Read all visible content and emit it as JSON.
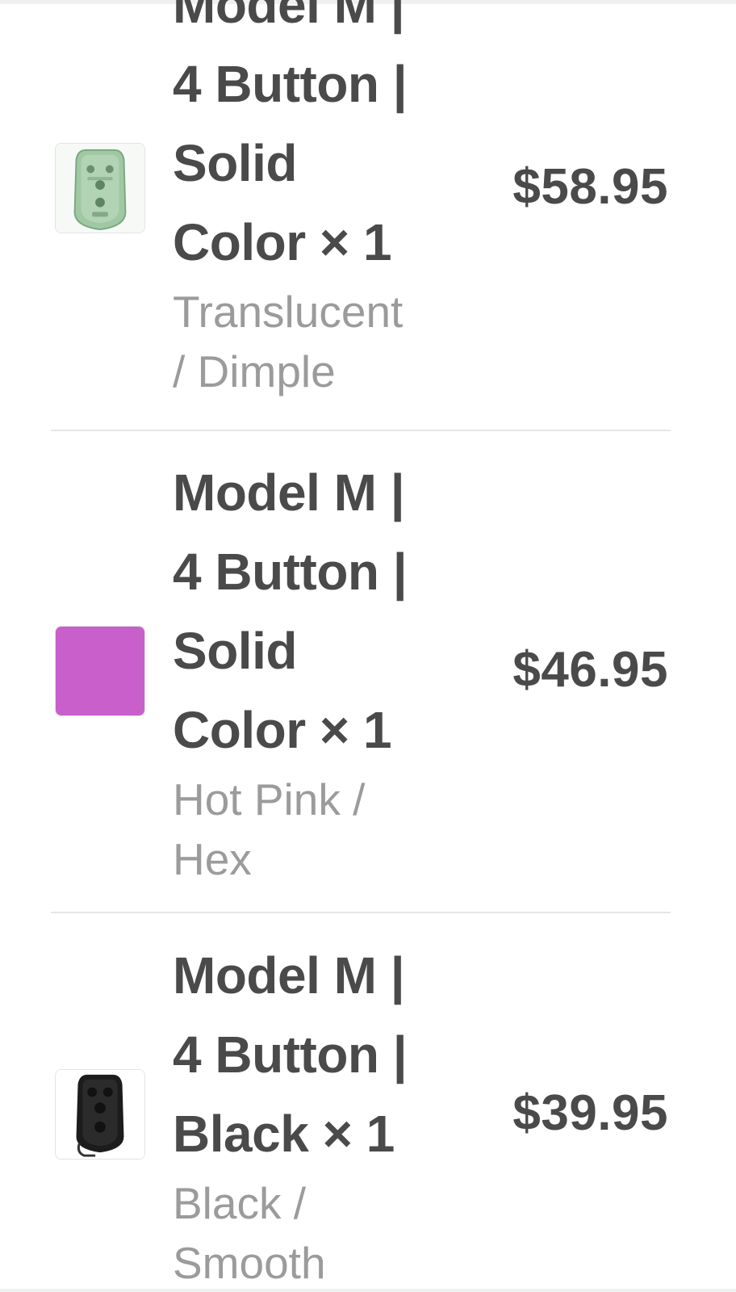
{
  "line_items": [
    {
      "title_lines": [
        "Model M |",
        "4 Button |",
        "Solid",
        "Color × 1"
      ],
      "variant_lines": [
        "Translucent",
        "/ Dimple"
      ],
      "price": "$58.95",
      "thumbnail": {
        "icon": "translucent-green-key-fob-icon",
        "color": "#8fbf95"
      }
    },
    {
      "title_lines": [
        "Model M |",
        "4 Button |",
        "Solid",
        "Color × 1"
      ],
      "variant_lines": [
        "Hot Pink /",
        "Hex"
      ],
      "price": "$46.95",
      "thumbnail": {
        "icon": "hot-pink-swatch-icon",
        "color": "#c65ac8"
      }
    },
    {
      "title_lines": [
        "Model M |",
        "4 Button |",
        "Black × 1"
      ],
      "variant_lines": [
        "Black /",
        "Smooth"
      ],
      "price": "$39.95",
      "thumbnail": {
        "icon": "black-key-fob-icon",
        "color": "#1c1c1c"
      }
    }
  ]
}
